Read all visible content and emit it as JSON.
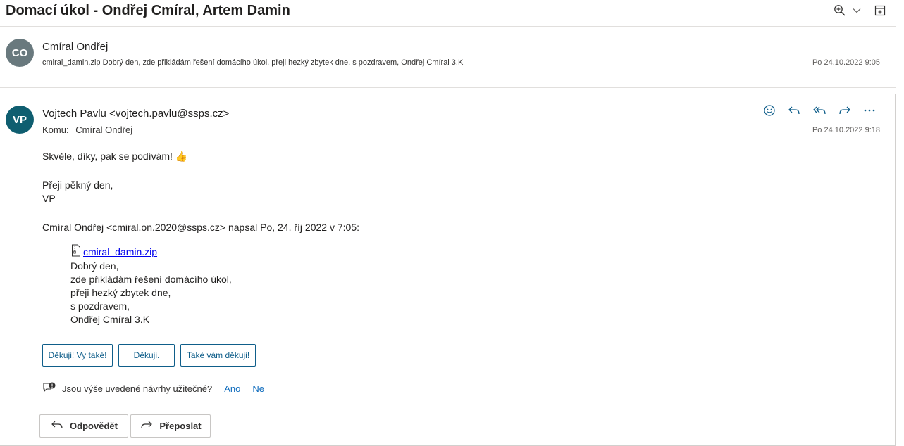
{
  "thread": {
    "subject": "Domací úkol - Ondřej Cmíral, Artem Damin"
  },
  "header_icons": [
    "zoom-icon",
    "chevron-down-icon",
    "open-in-window-icon"
  ],
  "messages": [
    {
      "initials": "CO",
      "avatar_color": "#69797e",
      "sender": "Cmíral Ondřej",
      "preview": "cmiral_damin.zip Dobrý den, zde přikládám řešení domácího úkol, přeji hezký zbytek dne, s pozdravem, Ondřej Cmíral 3.K",
      "date": "Po 24.10.2022 9:05"
    },
    {
      "initials": "VP",
      "avatar_color": "#0f5e70",
      "sender": "Vojtech Pavlu <vojtech.pavlu@ssps.cz>",
      "to_label": "Komu:",
      "to": "Cmíral Ondřej",
      "date": "Po 24.10.2022 9:18",
      "body": {
        "line1": "Skvěle, díky, pak se podívám! 👍",
        "line2": "Přeji pěkný den,",
        "line3": "VP",
        "quote_header": "Cmíral Ondřej <cmiral.on.2020@ssps.cz> napsal Po, 24. říj 2022 v 7:05:",
        "attachment": "cmiral_damin.zip",
        "quote_lines": [
          "Dobrý den,",
          "zde přikládám řešení domácího úkol,",
          "přeji hezký zbytek dne,",
          "s pozdravem,",
          "Ondřej Cmíral 3.K"
        ]
      }
    }
  ],
  "suggested_replies": [
    "Děkuji! Vy také!",
    "Děkuji.",
    "Také vám děkuji!"
  ],
  "feedback": {
    "question": "Jsou výše uvedené návrhy užitečné?",
    "yes": "Ano",
    "no": "Ne"
  },
  "actions": {
    "reply": "Odpovědět",
    "forward": "Přeposlat"
  },
  "colors": {
    "accent": "#0f5e8a",
    "link": "#0f6cbd"
  }
}
